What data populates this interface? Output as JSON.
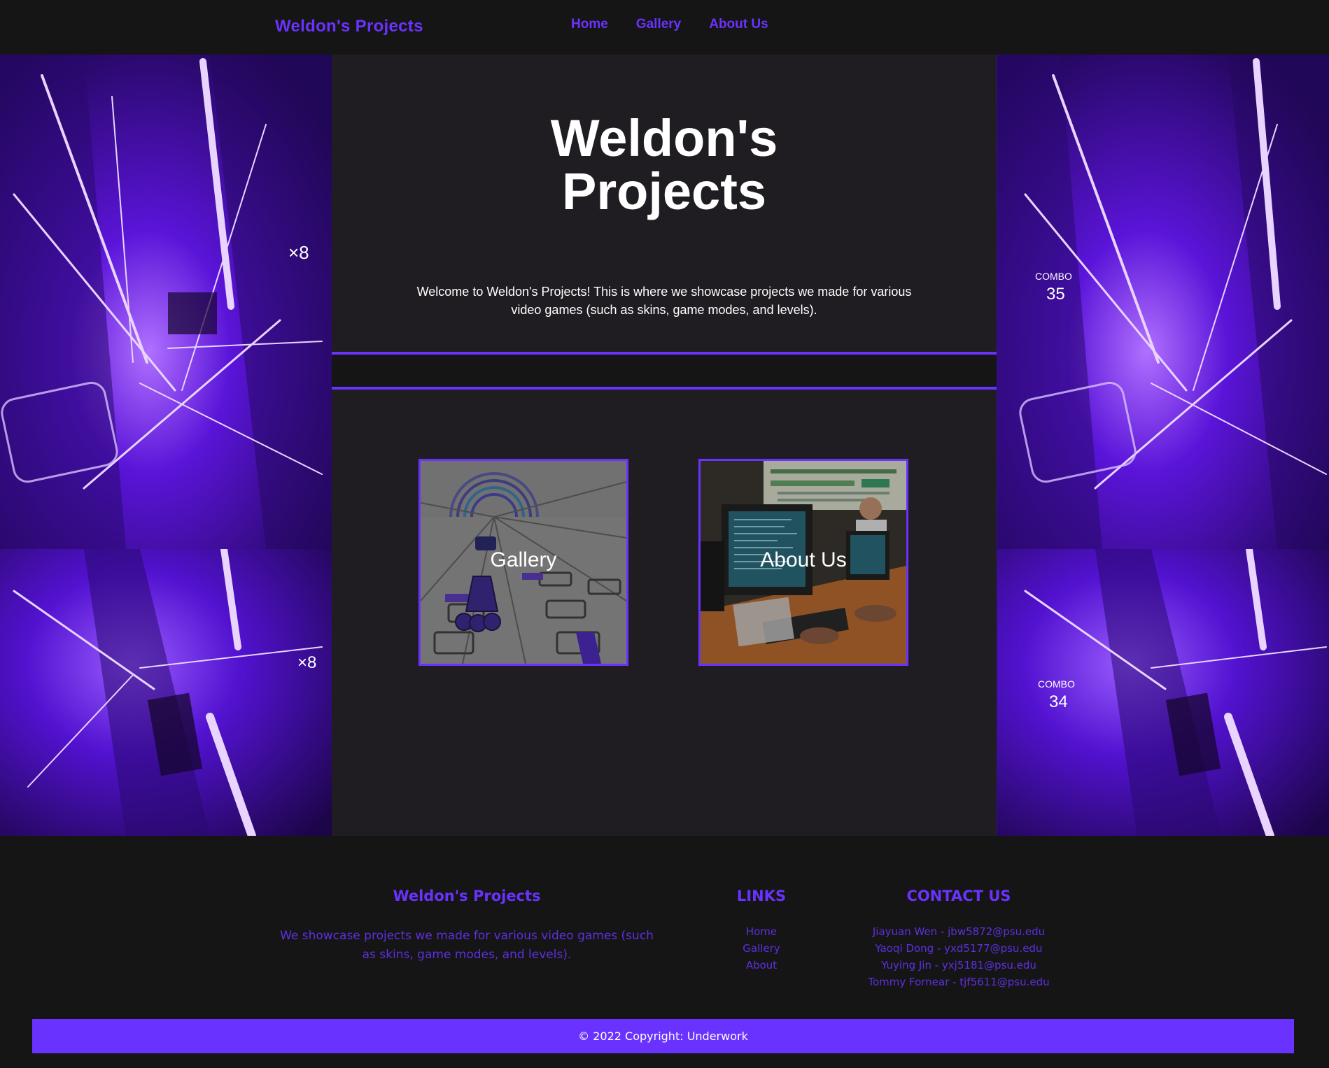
{
  "nav": {
    "brand": "Weldon's Projects",
    "links": [
      "Home",
      "Gallery",
      "About Us"
    ]
  },
  "hero": {
    "title_line1": "Weldon's",
    "title_line2": "Projects",
    "welcome": "Welcome to Weldon's Projects! This is where we showcase projects we made for various video games (such as skins, game modes, and levels)."
  },
  "cards": [
    {
      "label": "Gallery"
    },
    {
      "label": "About Us"
    }
  ],
  "footer": {
    "brand_title": "Weldon's Projects",
    "description": "We showcase projects we made for various video games (such as skins, game modes, and levels).",
    "links_title": "LINKS",
    "links": [
      "Home",
      "Gallery",
      "About"
    ],
    "contact_title": "CONTACT US",
    "contacts": [
      "Jiayuan Wen - jbw5872@psu.edu",
      "Yaoqi Dong - yxd5177@psu.edu",
      "Yuying Jin - yxj5181@psu.edu",
      "Tommy Fornear - tjf5611@psu.edu"
    ],
    "copyright": "© 2022 Copyright: Underwork"
  },
  "background_art": {
    "combo_labels": [
      "COMBO",
      "COMBO"
    ],
    "combo_values": [
      "35",
      "34"
    ],
    "multiplier": "×8"
  },
  "colors": {
    "accent": "#6a32ff",
    "page_bg": "#151515",
    "center_bg": "#1f1d22",
    "bg_art_purple": "#5a1ad8"
  }
}
